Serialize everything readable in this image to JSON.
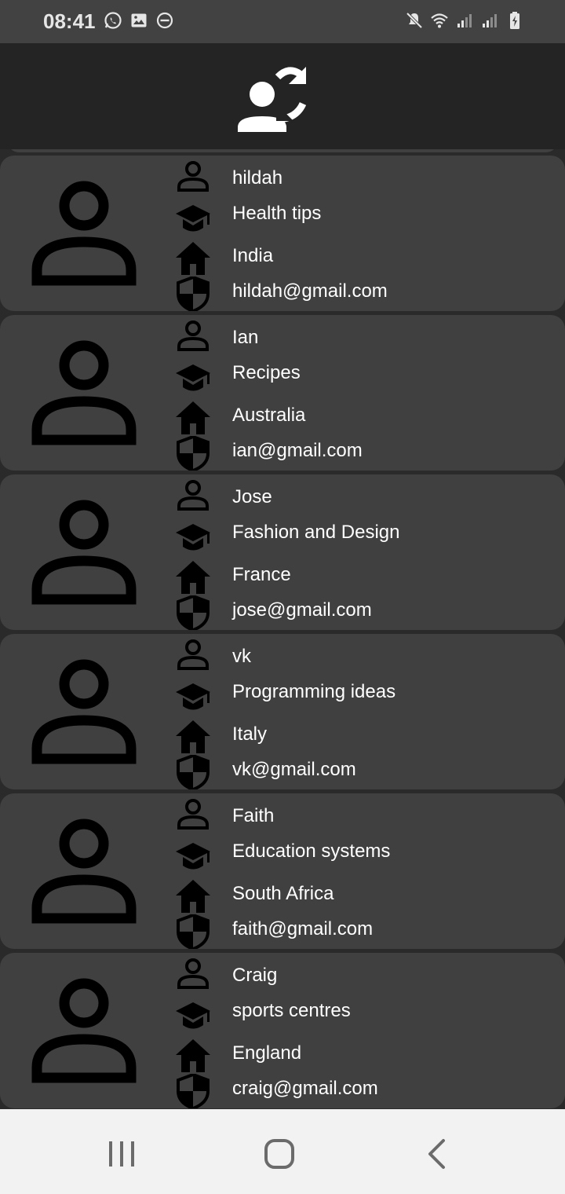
{
  "status_bar": {
    "time": "08:41",
    "left_icons": [
      "whatsapp-icon",
      "image-icon",
      "do-not-disturb-icon"
    ],
    "right_icons": [
      "mute-icon",
      "wifi-icon",
      "signal-icon",
      "signal-icon",
      "battery-icon"
    ]
  },
  "app_bar": {
    "icon": "refresh-user-icon"
  },
  "contacts": [
    {
      "name": "hildah",
      "category": "Health tips",
      "country": "India",
      "email": "hildah@gmail.com"
    },
    {
      "name": "Ian",
      "category": "Recipes",
      "country": "Australia",
      "email": "ian@gmail.com"
    },
    {
      "name": "Jose",
      "category": "Fashion and Design",
      "country": "France",
      "email": "jose@gmail.com"
    },
    {
      "name": "vk",
      "category": "Programming ideas",
      "country": "Italy",
      "email": "vk@gmail.com"
    },
    {
      "name": "Faith",
      "category": "Education systems",
      "country": "South Africa",
      "email": "faith@gmail.com"
    },
    {
      "name": "Craig",
      "category": "sports centres",
      "country": "England",
      "email": "craig@gmail.com"
    }
  ],
  "nav_bar": {
    "buttons": [
      "recents-button",
      "home-button",
      "back-button"
    ]
  },
  "colors": {
    "card": "#404040",
    "background": "#2a2a2a",
    "app_bar": "#242424",
    "status_bar": "#424242",
    "text": "#ffffff",
    "icon": "#000000"
  }
}
